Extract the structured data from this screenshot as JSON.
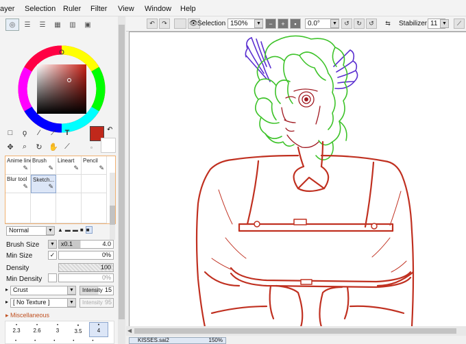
{
  "menu": [
    "ayer",
    "Selection",
    "Ruler",
    "Filter",
    "View",
    "Window",
    "Help"
  ],
  "brush_slots": [
    {
      "label": "Anime line"
    },
    {
      "label": "Brush"
    },
    {
      "label": "Lineart"
    },
    {
      "label": "Pencil"
    },
    {
      "label": "Blur tool"
    },
    {
      "label": "Sketch..."
    }
  ],
  "blend_mode": "Normal",
  "brush_size": {
    "label": "Brush Size",
    "multiplier": "x0.1",
    "value": "4.0"
  },
  "min_size": {
    "label": "Min Size",
    "value": "0%"
  },
  "density": {
    "label": "Density",
    "value": "100"
  },
  "min_density": {
    "label": "Min Density",
    "value": "0%"
  },
  "texture1": {
    "value": "Crust",
    "intensity_label": "Intensity",
    "intensity": "15"
  },
  "texture2": {
    "value": "[ No Texture ]",
    "intensity_label": "Intensity",
    "intensity": "95"
  },
  "misc_label": "Miscellaneous",
  "size_presets": [
    "2.3",
    "2.6",
    "3",
    "3.5",
    "4"
  ],
  "toolbar": {
    "selection_label": "Selection",
    "zoom": "150%",
    "angle": "0.0°",
    "stabilizer_label": "Stabilizer",
    "stabilizer_value": "11"
  },
  "file_tab": {
    "name": "KISSES.sai2",
    "zoom": "150%"
  },
  "colors": {
    "primary": "#c0281b",
    "secondary": "#ffffff",
    "hair": "#3ec32a",
    "wings": "#5a2fd0",
    "lineart": "#c03020"
  }
}
